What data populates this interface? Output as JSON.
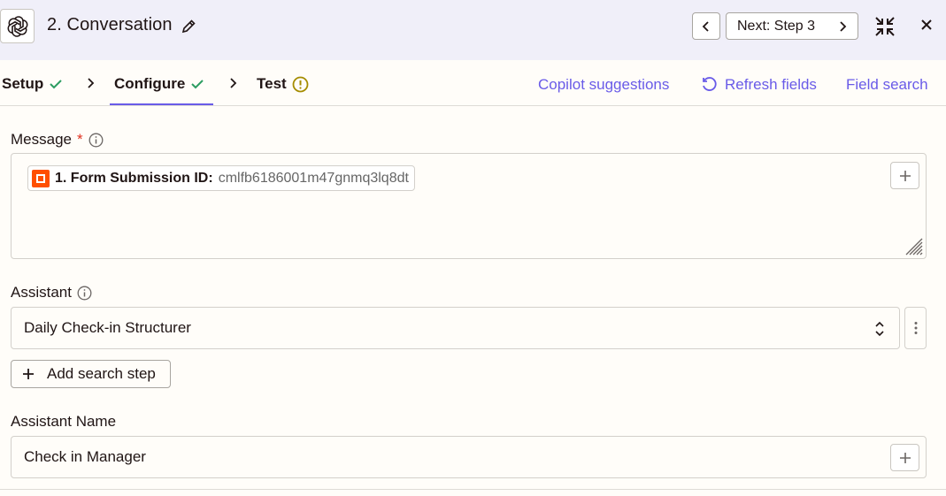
{
  "header": {
    "step_title": "2. Conversation",
    "next_label": "Next: Step 3"
  },
  "tabs": [
    {
      "label": "Setup",
      "status": "complete"
    },
    {
      "label": "Configure",
      "status": "complete",
      "active": true
    },
    {
      "label": "Test",
      "status": "warning"
    }
  ],
  "actions": {
    "copilot": "Copilot suggestions",
    "refresh": "Refresh fields",
    "field_search": "Field search"
  },
  "message": {
    "label": "Message",
    "required_mark": "*",
    "pill_key": "1. Form Submission ID:",
    "pill_value": "cmlfb6186001m47gnmq3lq8dt"
  },
  "assistant": {
    "label": "Assistant",
    "selected": "Daily Check-in Structurer",
    "add_search_step": "Add search step"
  },
  "assistant_name": {
    "label": "Assistant Name",
    "value": "Check in Manager"
  },
  "colors": {
    "accent": "#695be8",
    "check": "#2c9d62",
    "warning": "#a58c00",
    "header_bg": "#f0eff9",
    "app_brand": "#ff4f00",
    "required": "#e0301e"
  }
}
